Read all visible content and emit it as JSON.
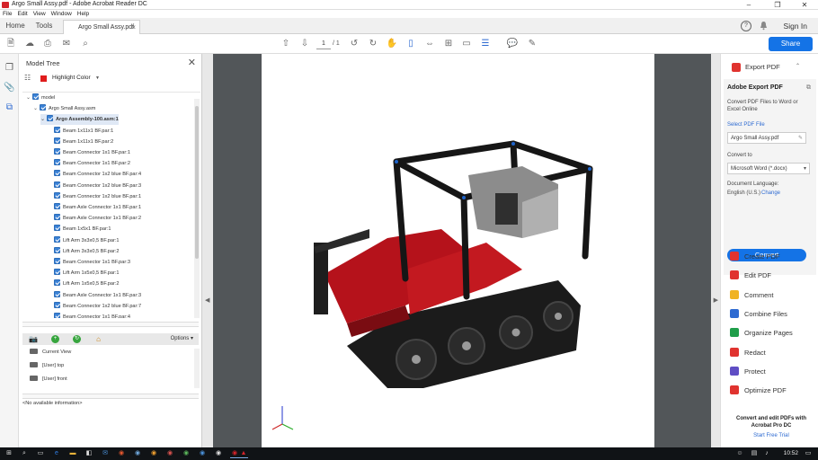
{
  "titlebar": {
    "title": "Argo Small Assy.pdf - Adobe Acrobat Reader DC",
    "minimize": "–",
    "restore": "❐",
    "close": "✕"
  },
  "menu": [
    "File",
    "Edit",
    "View",
    "Window",
    "Help"
  ],
  "tabs": {
    "home": "Home",
    "tools": "Tools",
    "document": "Argo Small Assy.pdf",
    "close": "×"
  },
  "header": {
    "sign_in": "Sign In",
    "help": "?"
  },
  "toolbar": {
    "page_current": "1",
    "page_total": "/ 1",
    "share": "Share"
  },
  "model_tree": {
    "title": "Model Tree",
    "highlight_label": "Highlight Color",
    "highlight_color": "#e01c1c",
    "items": [
      {
        "label": "model",
        "indent": 0
      },
      {
        "label": "Argo Small Assy.asm",
        "indent": 1
      },
      {
        "label": "Argo Assembly-100.asm:1",
        "indent": 2,
        "selected": true
      },
      {
        "label": "Beam 1x11x1 BF.par:1",
        "indent": 3
      },
      {
        "label": "Beam 1x11x1 BF.par:2",
        "indent": 3
      },
      {
        "label": "Beam Connector 1x1 BF.par:1",
        "indent": 3
      },
      {
        "label": "Beam Connector 1x1 BF.par:2",
        "indent": 3
      },
      {
        "label": "Beam Connector 1x2 blue BF.par:4",
        "indent": 3
      },
      {
        "label": "Beam Connector 1x2 blue BF.par:3",
        "indent": 3
      },
      {
        "label": "Beam Connector 1x2 blue BF.par:1",
        "indent": 3
      },
      {
        "label": "Beam Axle Connector 1x1 BF.par:1",
        "indent": 3
      },
      {
        "label": "Beam Axle Connector 1x1 BF.par:2",
        "indent": 3
      },
      {
        "label": "Beam 1x5x1 BF.par:1",
        "indent": 3
      },
      {
        "label": "Lift Arm 3x3x0,5 BF.par:1",
        "indent": 3
      },
      {
        "label": "Lift Arm 3x3x0,5 BF.par:2",
        "indent": 3
      },
      {
        "label": "Beam Connector 1x1 BF.par:3",
        "indent": 3
      },
      {
        "label": "Lift Arm 1x5x0,5 BF.par:1",
        "indent": 3
      },
      {
        "label": "Lift Arm 1x5x0,5 BF.par:2",
        "indent": 3
      },
      {
        "label": "Beam Axle Connector 1x1 BF.par:3",
        "indent": 3
      },
      {
        "label": "Beam Connector 1x2 blue BF.par:7",
        "indent": 3
      },
      {
        "label": "Beam Connector 1x1 BF.par:4",
        "indent": 3
      }
    ],
    "views_options": "Options",
    "views": [
      "Current View",
      "[User] top",
      "[User] front"
    ],
    "info": "<No available information>"
  },
  "tools_panel": {
    "export_header": "Export PDF",
    "export_title": "Adobe Export PDF",
    "export_desc": "Convert PDF Files to Word or Excel Online",
    "select_pdf": "Select PDF File",
    "file_name": "Argo Small Assy.pdf",
    "convert_to_label": "Convert to",
    "convert_to_value": "Microsoft Word (*.docx)",
    "doc_language_label": "Document Language:",
    "doc_language_value": "English (U.S.)",
    "change": "Change",
    "convert": "Convert",
    "tools": [
      {
        "label": "Create PDF",
        "color": "#e0332f"
      },
      {
        "label": "Edit PDF",
        "color": "#e0332f"
      },
      {
        "label": "Comment",
        "color": "#f0b323"
      },
      {
        "label": "Combine Files",
        "color": "#2d6ad1"
      },
      {
        "label": "Organize Pages",
        "color": "#1f9e4a"
      },
      {
        "label": "Redact",
        "color": "#e0332f"
      },
      {
        "label": "Protect",
        "color": "#5f4ec4"
      },
      {
        "label": "Optimize PDF",
        "color": "#e0332f"
      }
    ],
    "promo": "Convert and edit PDFs with Acrobat Pro DC",
    "trial": "Start Free Trial"
  },
  "taskbar": {
    "time": "10:52"
  }
}
